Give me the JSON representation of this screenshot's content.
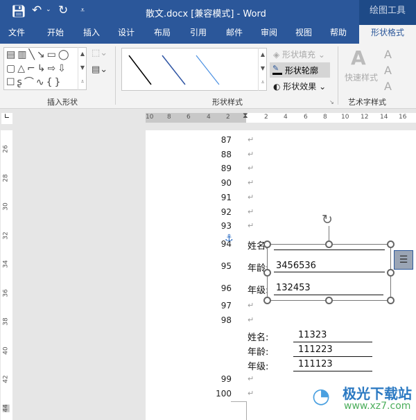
{
  "title": {
    "doc": "散文.docx [兼容模式]  -  Word",
    "context": "绘图工具"
  },
  "tabs": [
    "文件",
    "开始",
    "插入",
    "设计",
    "布局",
    "引用",
    "邮件",
    "审阅",
    "视图",
    "帮助",
    "形状格式"
  ],
  "ribbon": {
    "groups": [
      "插入形状",
      "形状样式",
      "艺术字样式"
    ],
    "shape_fill": "形状填充",
    "shape_outline": "形状轮廓",
    "shape_effect": "形状效果",
    "quick_styles": "快速样式"
  },
  "ruler": {
    "h_left": [
      "10",
      "8",
      "6",
      "4",
      "2"
    ],
    "h_right": [
      "2",
      "4",
      "6",
      "8",
      "10",
      "12",
      "14",
      "16"
    ],
    "v": [
      "26",
      "28",
      "30",
      "32",
      "34",
      "36",
      "38",
      "40",
      "42",
      "44"
    ]
  },
  "doc": {
    "line_numbers": [
      "87",
      "88",
      "89",
      "90",
      "91",
      "92",
      "93",
      "94",
      "95",
      "96",
      "97",
      "98",
      "99",
      "100"
    ],
    "textbox": [
      {
        "label": "姓名:",
        "value": ""
      },
      {
        "label": "年龄:",
        "value": "3456536"
      },
      {
        "label": "年级:",
        "value": "132453"
      }
    ],
    "table": [
      {
        "label": "姓名:",
        "value": "11323"
      },
      {
        "label": "年龄:",
        "value": "111223"
      },
      {
        "label": "年级:",
        "value": "111123"
      }
    ],
    "mark": "↵"
  },
  "watermark": {
    "name": "极光下载站",
    "url": "www.xz7.com"
  },
  "colors": {
    "brand": "#2b579a",
    "accent_line": "#4472c4"
  }
}
